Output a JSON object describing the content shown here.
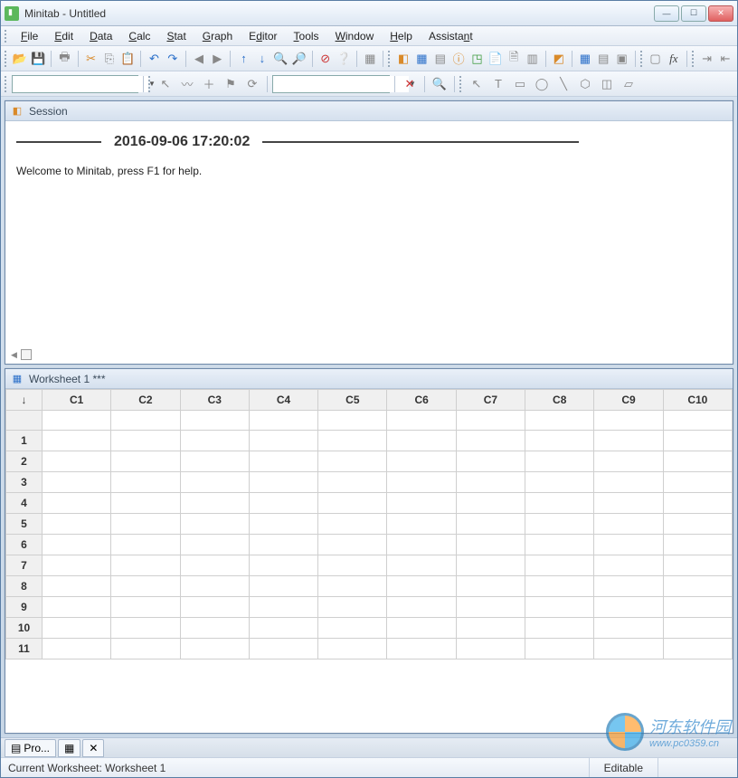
{
  "window": {
    "title": "Minitab - Untitled"
  },
  "winbtns": {
    "min": "—",
    "max": "☐",
    "close": "✕"
  },
  "menu": {
    "file": "File",
    "edit": "Edit",
    "data": "Data",
    "calc": "Calc",
    "stat": "Stat",
    "graph": "Graph",
    "editor": "Editor",
    "tools": "Tools",
    "window": "Window",
    "help": "Help",
    "assistant": "Assistant"
  },
  "session": {
    "title": "Session",
    "timestamp": "2016-09-06 17:20:02",
    "welcome": "Welcome to Minitab, press F1 for help."
  },
  "worksheet": {
    "title": "Worksheet 1 ***",
    "corner": "↓",
    "cols": [
      "C1",
      "C2",
      "C3",
      "C4",
      "C5",
      "C6",
      "C7",
      "C8",
      "C9",
      "C10"
    ],
    "rows": [
      "1",
      "2",
      "3",
      "4",
      "5",
      "6",
      "7",
      "8",
      "9",
      "10",
      "11"
    ]
  },
  "tabs": {
    "project": "Pro...",
    "t2": "",
    "t3": ""
  },
  "status": {
    "current": "Current Worksheet: Worksheet 1",
    "editable": "Editable"
  },
  "watermark": {
    "name": "河东软件园",
    "url": "www.pc0359.cn"
  },
  "fx": "fx"
}
